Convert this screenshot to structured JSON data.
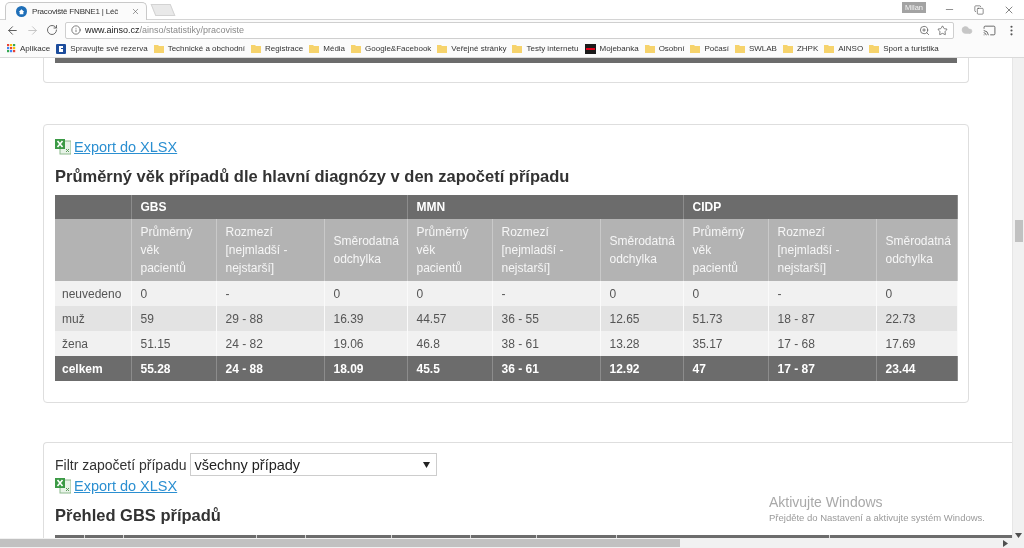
{
  "browser": {
    "tabs": [
      {
        "title": "Pracoviště FNBNE1 | Léč",
        "selected": true
      }
    ],
    "profile_name": "Milan",
    "address": {
      "host": "www.ainso.cz",
      "path": "/ainso/statistiky/pracoviste"
    },
    "bookmarks": [
      {
        "kind": "apps",
        "label": "Aplikace"
      },
      {
        "kind": "site",
        "label": "Spravujte své rezerva"
      },
      {
        "kind": "folder",
        "label": "Technické a obchodní"
      },
      {
        "kind": "folder",
        "label": "Registrace"
      },
      {
        "kind": "folder",
        "label": "Média"
      },
      {
        "kind": "folder",
        "label": "Google&Facebook"
      },
      {
        "kind": "folder",
        "label": "Veřejné stránky"
      },
      {
        "kind": "folder",
        "label": "Testy internetu"
      },
      {
        "kind": "bank",
        "label": "Mojebanka"
      },
      {
        "kind": "folder",
        "label": "Osobní"
      },
      {
        "kind": "folder",
        "label": "Počasí"
      },
      {
        "kind": "folder",
        "label": "SWLAB"
      },
      {
        "kind": "folder",
        "label": "ZHPK"
      },
      {
        "kind": "folder",
        "label": "AINSO"
      },
      {
        "kind": "folder",
        "label": "Sport a turistika"
      }
    ]
  },
  "age_report": {
    "export_link": "Export do XLSX",
    "title": "Průměrný věk případů dle hlavní diagnózy v den započetí případu",
    "table": {
      "groups": [
        {
          "name": "GBS",
          "columns": [
            "Průměrný věk pacientů",
            "Rozmezí [nejmladší - nejstarší]",
            "Směrodatná odchylka"
          ]
        },
        {
          "name": "MMN",
          "columns": [
            "Průměrný věk pacientů",
            "Rozmezí [nejmladší - nejstarší]",
            "Směrodatná odchylka"
          ]
        },
        {
          "name": "CIDP",
          "columns": [
            "Průměrný věk pacientů",
            "Rozmezí [nejmladší - nejstarší]",
            "Směrodatná odchylka"
          ]
        }
      ],
      "rows": [
        {
          "kind": "data",
          "label": "neuvedeno",
          "cells": [
            "0",
            "-",
            "0",
            "0",
            "-",
            "0",
            "0",
            "-",
            "0"
          ]
        },
        {
          "kind": "data",
          "label": "muž",
          "cells": [
            "59",
            "29 - 88",
            "16.39",
            "44.57",
            "36 - 55",
            "12.65",
            "51.73",
            "18 - 87",
            "22.73"
          ]
        },
        {
          "kind": "data",
          "label": "žena",
          "cells": [
            "51.15",
            "24 - 82",
            "19.06",
            "46.8",
            "38 - 61",
            "13.28",
            "35.17",
            "17 - 68",
            "17.69"
          ]
        },
        {
          "kind": "total",
          "label": "celkem",
          "cells": [
            "55.28",
            "24 - 88",
            "18.09",
            "45.5",
            "36 - 61",
            "12.92",
            "47",
            "17 - 87",
            "23.44"
          ]
        }
      ]
    }
  },
  "gbs_report": {
    "filter_label": "Filtr započetí případu",
    "filter_value": "všechny případy",
    "export_link": "Export do XLSX",
    "title": "Přehled GBS případů"
  },
  "windows_notice": {
    "title": "Aktivujte Windows",
    "text": "Přejděte do Nastavení a aktivujte systém Windows."
  }
}
